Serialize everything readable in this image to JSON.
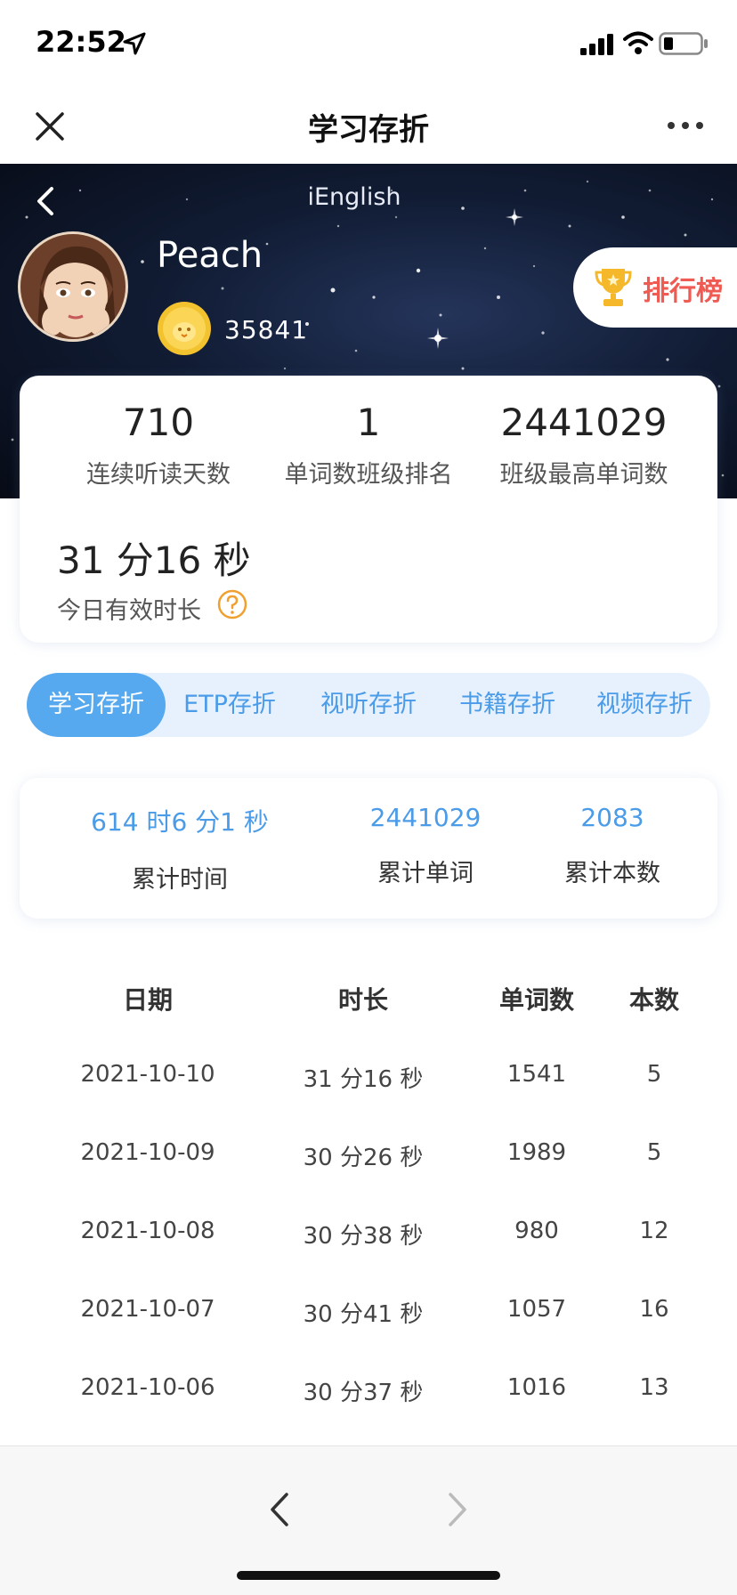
{
  "status_bar": {
    "time": "22:52"
  },
  "nav": {
    "title": "学习存折"
  },
  "hero": {
    "app_name": "iEnglish",
    "username": "Peach",
    "coins": "35841",
    "ranking_label": "排行榜"
  },
  "stats": [
    {
      "value": "710",
      "label": "连续听读天数"
    },
    {
      "value": "1",
      "label": "单词数班级排名"
    },
    {
      "value": "2441029",
      "label": "班级最高单词数"
    }
  ],
  "today": {
    "value": "31 分16 秒",
    "label": "今日有效时长"
  },
  "tabs": [
    {
      "label": "学习存折",
      "active": true
    },
    {
      "label": "ETP存折",
      "active": false
    },
    {
      "label": "视听存折",
      "active": false
    },
    {
      "label": "书籍存折",
      "active": false
    },
    {
      "label": "视频存折",
      "active": false
    }
  ],
  "summary": [
    {
      "value": "614 时6 分1 秒",
      "label": "累计时间"
    },
    {
      "value": "2441029",
      "label": "累计单词"
    },
    {
      "value": "2083",
      "label": "累计本数"
    }
  ],
  "table": {
    "headers": [
      "日期",
      "时长",
      "单词数",
      "本数"
    ],
    "rows": [
      [
        "2021-10-10",
        "31 分16 秒",
        "1541",
        "5"
      ],
      [
        "2021-10-09",
        "30 分26 秒",
        "1989",
        "5"
      ],
      [
        "2021-10-08",
        "30 分38 秒",
        "980",
        "12"
      ],
      [
        "2021-10-07",
        "30 分41 秒",
        "1057",
        "16"
      ],
      [
        "2021-10-06",
        "30 分37 秒",
        "1016",
        "13"
      ]
    ]
  },
  "colors": {
    "accent": "#56a9ef",
    "accent_text": "#4a9be8",
    "ranking_red": "#ef5a52",
    "coin_gold": "#f3c22f"
  }
}
